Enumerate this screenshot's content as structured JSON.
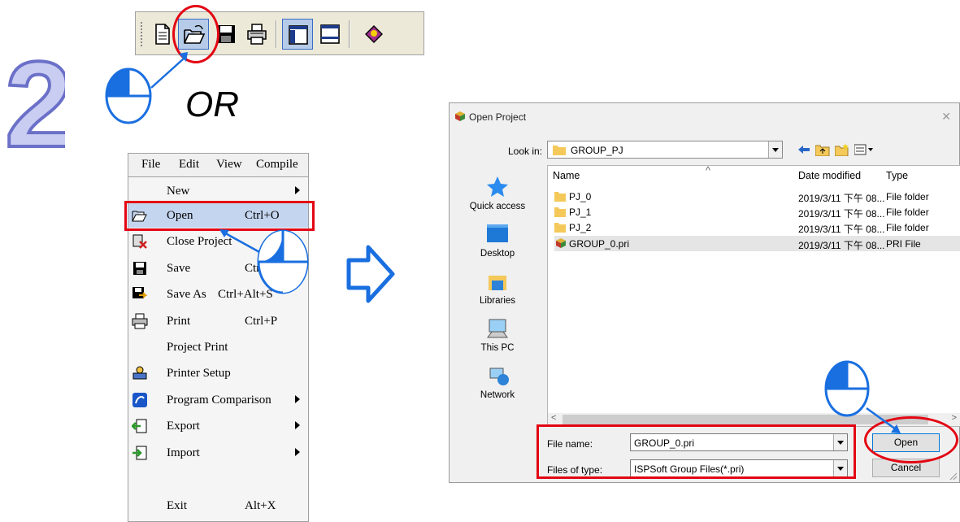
{
  "step_number": "2",
  "or_label": "OR",
  "toolbar": {
    "buttons": [
      "new-icon",
      "open-icon",
      "save-icon",
      "print-icon",
      "layout-icon",
      "window-icon",
      "help-book-icon"
    ]
  },
  "menubar": {
    "items": [
      "File",
      "Edit",
      "View",
      "Compile"
    ]
  },
  "file_menu": {
    "items": [
      {
        "label": "New",
        "shortcut": "",
        "submenu": true
      },
      {
        "label": "Open",
        "shortcut": "Ctrl+O",
        "submenu": false
      },
      {
        "label": "Close Project",
        "shortcut": "",
        "submenu": false
      },
      {
        "label": "Save",
        "shortcut": "Ctrl",
        "submenu": false
      },
      {
        "label": "Save As",
        "shortcut": "Ctrl+Alt+S",
        "submenu": false
      },
      {
        "label": "Print",
        "shortcut": "Ctrl+P",
        "submenu": false
      },
      {
        "label": "Project Print",
        "shortcut": "",
        "submenu": false
      },
      {
        "label": "Printer Setup",
        "shortcut": "",
        "submenu": false
      },
      {
        "label": "Program Comparison",
        "shortcut": "",
        "submenu": true
      },
      {
        "label": "Export",
        "shortcut": "",
        "submenu": true
      },
      {
        "label": "Import",
        "shortcut": "",
        "submenu": true
      },
      {
        "label": "Exit",
        "shortcut": "Alt+X",
        "submenu": false
      }
    ]
  },
  "dialog": {
    "title": "Open Project",
    "look_in_label": "Look in:",
    "look_in_value": "GROUP_PJ",
    "places": [
      "Quick access",
      "Desktop",
      "Libraries",
      "This PC",
      "Network"
    ],
    "columns": {
      "name": "Name",
      "date": "Date modified",
      "type": "Type"
    },
    "files": [
      {
        "name": "PJ_0",
        "date": "2019/3/11 下午 08...",
        "type": "File folder",
        "kind": "folder"
      },
      {
        "name": "PJ_1",
        "date": "2019/3/11 下午 08...",
        "type": "File folder",
        "kind": "folder"
      },
      {
        "name": "PJ_2",
        "date": "2019/3/11 下午 08...",
        "type": "File folder",
        "kind": "folder"
      },
      {
        "name": "GROUP_0.pri",
        "date": "2019/3/11 下午 08...",
        "type": "PRI File",
        "kind": "pri"
      }
    ],
    "file_name_label": "File name:",
    "file_name_value": "GROUP_0.pri",
    "file_type_label": "Files of type:",
    "file_type_value": "ISPSoft Group Files(*.pri)",
    "open_button": "Open",
    "cancel_button": "Cancel"
  },
  "colors": {
    "highlight": "#e30613",
    "accent": "#1a6fe0",
    "step": "#8a8fd6"
  }
}
